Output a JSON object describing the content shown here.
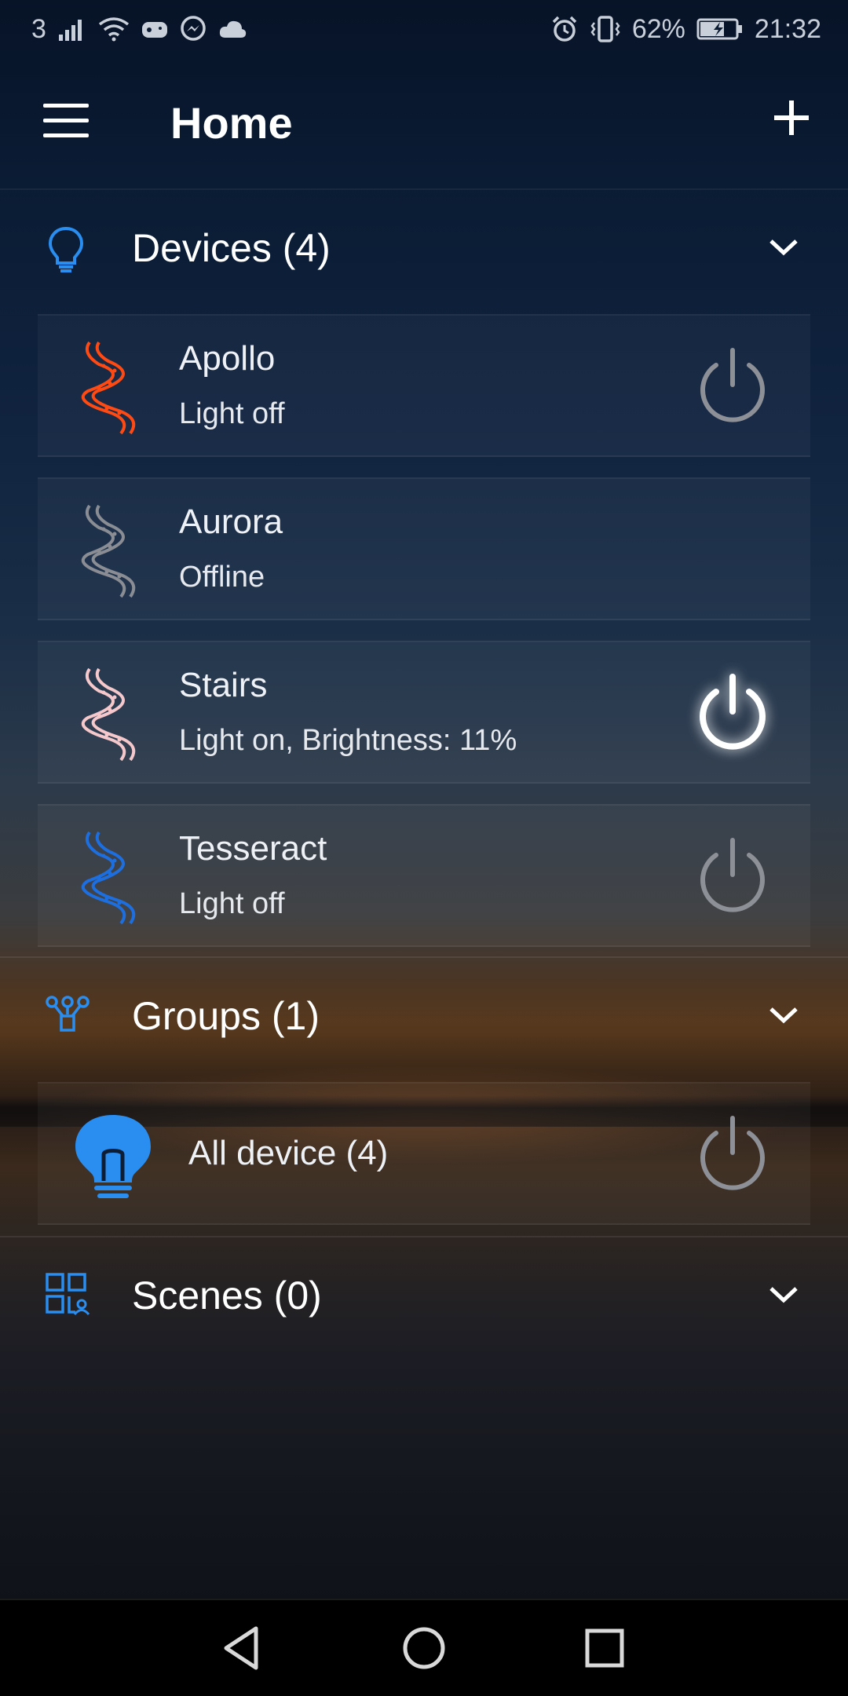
{
  "status_bar": {
    "carrier": "3",
    "battery": "62%",
    "time": "21:32"
  },
  "app_bar": {
    "title": "Home"
  },
  "sections": {
    "devices": {
      "title": "Devices (4)"
    },
    "groups": {
      "title": "Groups (1)"
    },
    "scenes": {
      "title": "Scenes (0)"
    }
  },
  "devices": [
    {
      "name": "Apollo",
      "status": "Light off",
      "icon_color": "#ff4a14",
      "power": "off"
    },
    {
      "name": "Aurora",
      "status": "Offline",
      "icon_color": "#8a8e94",
      "power": "none"
    },
    {
      "name": "Stairs",
      "status": "Light on, Brightness: 11%",
      "icon_color": "#f5c8cc",
      "power": "on"
    },
    {
      "name": "Tesseract",
      "status": "Light off",
      "icon_color": "#1d6fe0",
      "power": "off"
    }
  ],
  "groups": [
    {
      "name": "All device (4)",
      "icon": "bulb-icon",
      "icon_color": "#2a8df0",
      "power": "off"
    }
  ],
  "colors": {
    "accent": "#2a8df0",
    "power_off": "#8d9096",
    "power_on": "#ffffff"
  }
}
